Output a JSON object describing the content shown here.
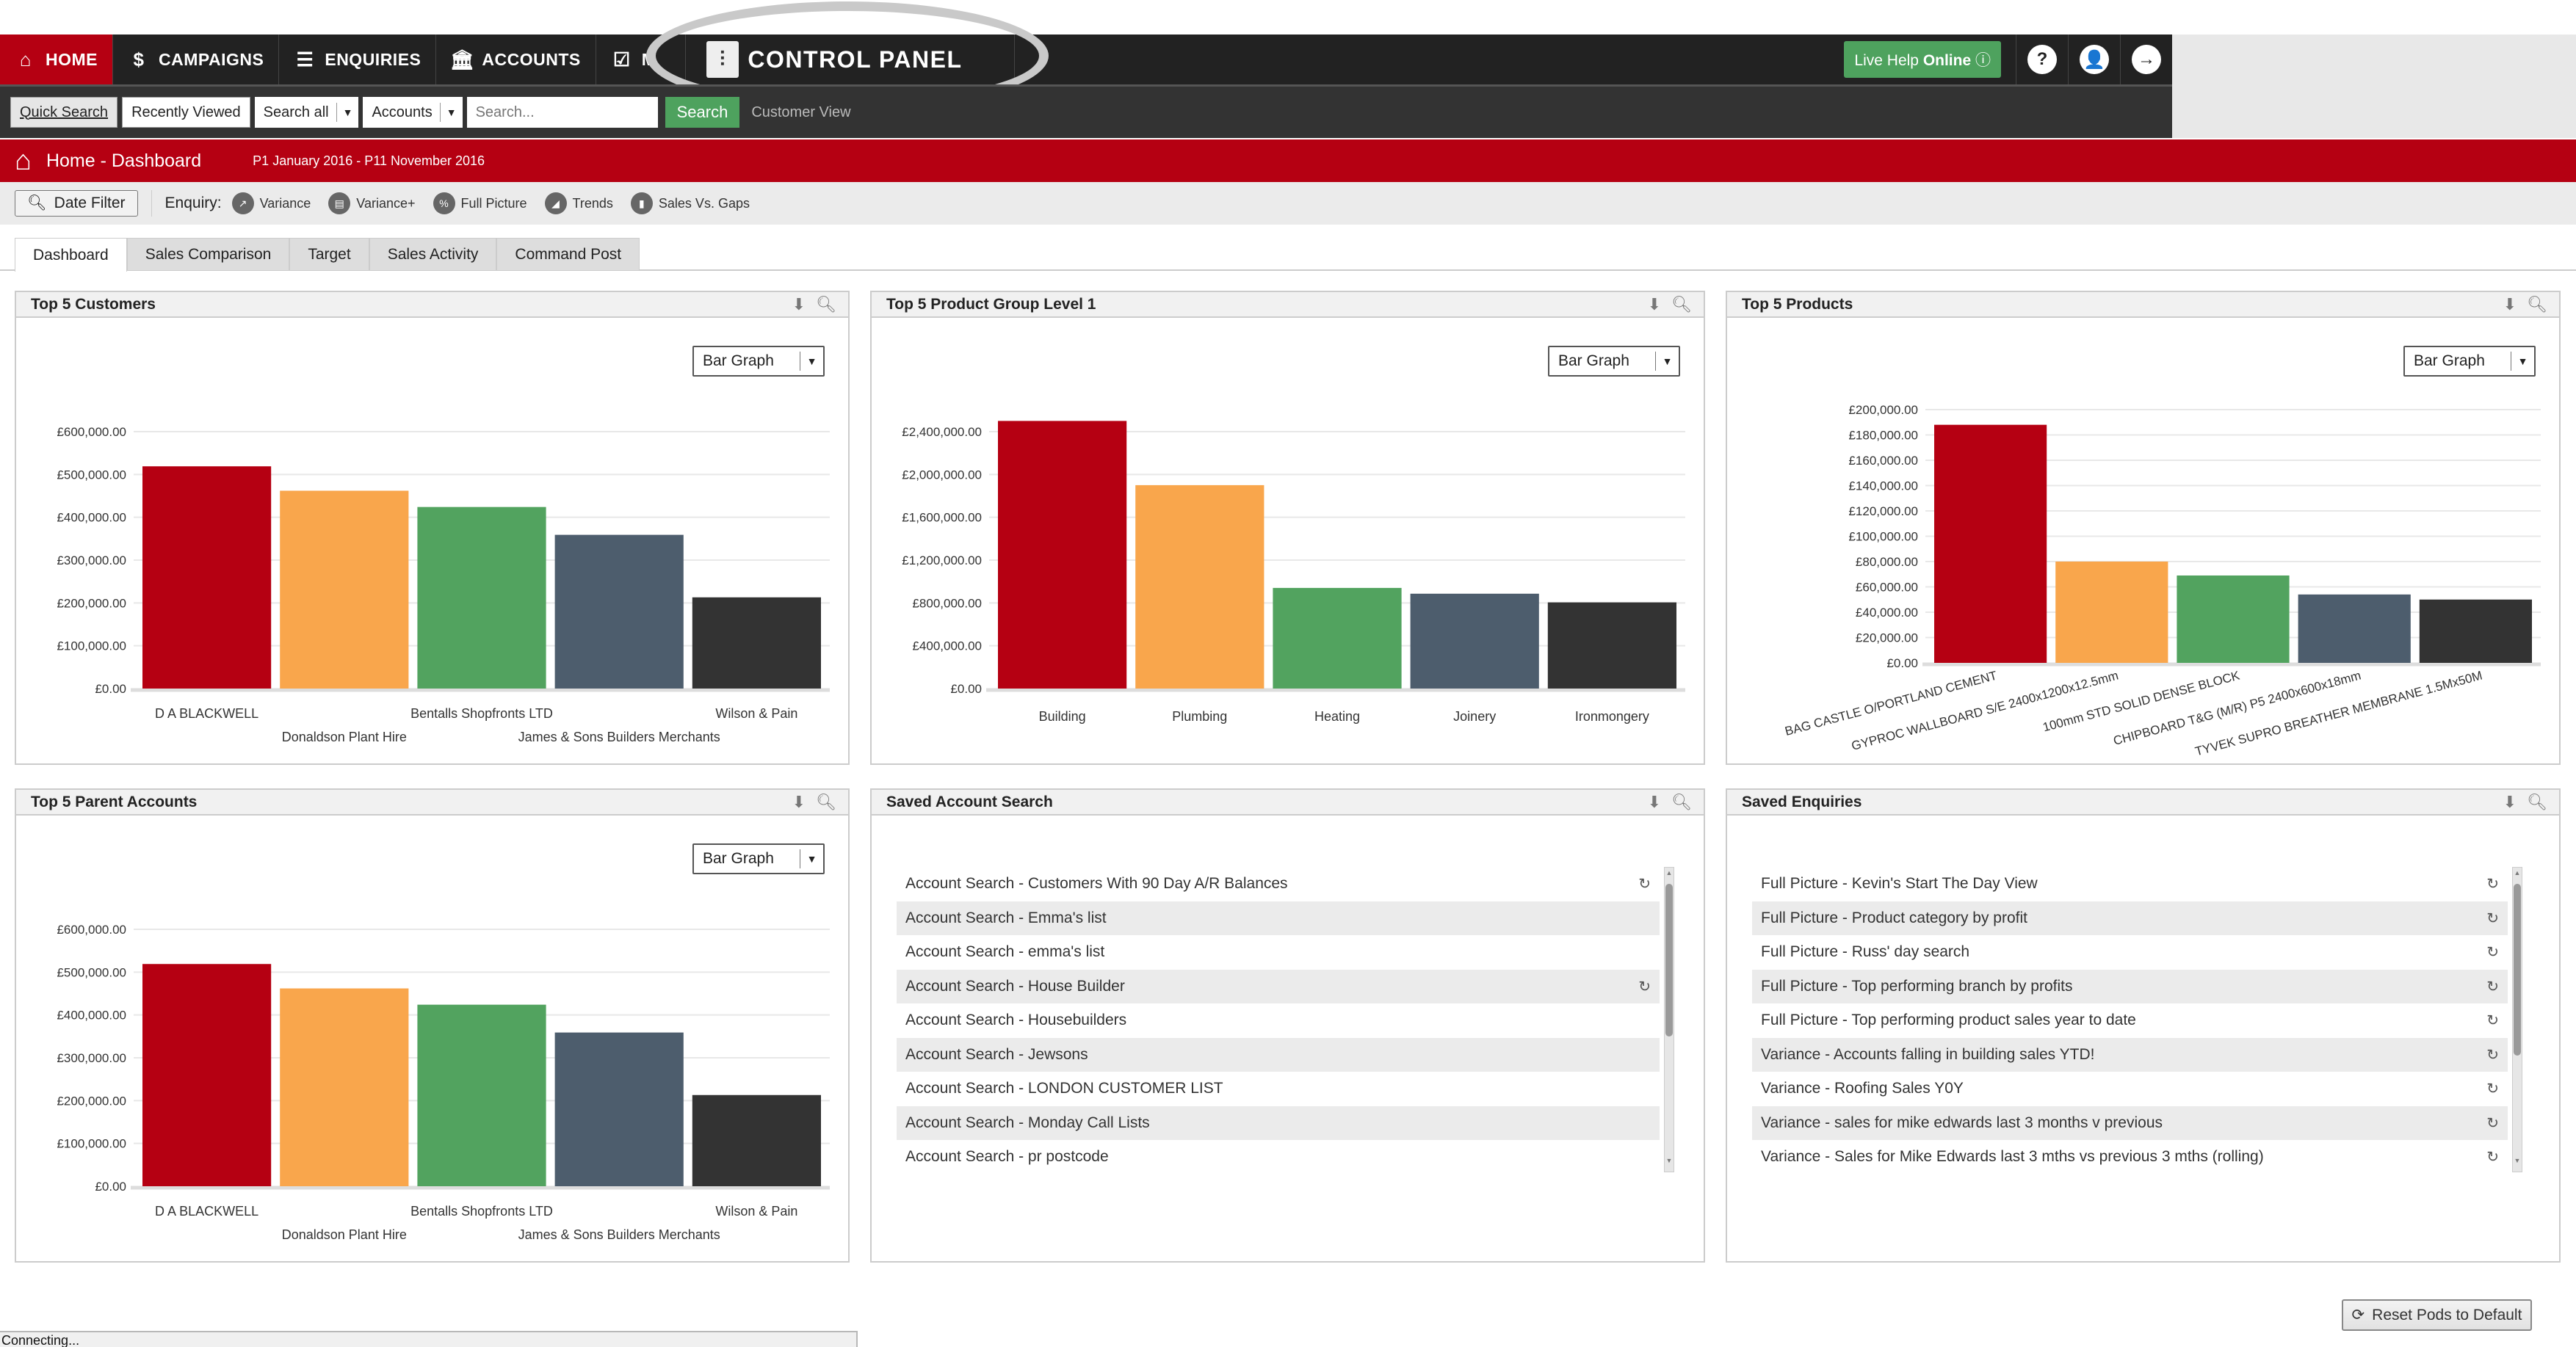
{
  "nav": {
    "items": [
      {
        "label": "HOME",
        "icon": "home-icon",
        "active": true
      },
      {
        "label": "CAMPAIGNS",
        "icon": "campaigns-icon",
        "active": false
      },
      {
        "label": "ENQUIRIES",
        "icon": "enquiries-icon",
        "active": false
      },
      {
        "label": "ACCOUNTS",
        "icon": "accounts-icon",
        "active": false
      },
      {
        "label": "M",
        "icon": "checklist-icon",
        "active": false
      }
    ],
    "control_panel": "CONTROL PANEL",
    "live_help_prefix": "Live Help ",
    "live_help_status": "Online",
    "help_icon": "?",
    "user_icon": "user-icon",
    "logout_icon": "logout-icon"
  },
  "searchbar": {
    "quick_search": "Quick Search",
    "recently_viewed": "Recently Viewed",
    "scope_select": "Search all",
    "type_select": "Accounts",
    "search_placeholder": "Search...",
    "search_button": "Search",
    "customer_view": "Customer View"
  },
  "breadcrumb": {
    "title": "Home - Dashboard",
    "date_range": "P1 January 2016 - P11 November 2016"
  },
  "toolbar": {
    "date_filter": "Date Filter",
    "enquiry_label": "Enquiry:",
    "enquiries": [
      {
        "label": "Variance",
        "icon": "variance-icon"
      },
      {
        "label": "Variance+",
        "icon": "variance-plus-icon"
      },
      {
        "label": "Full Picture",
        "icon": "full-picture-icon"
      },
      {
        "label": "Trends",
        "icon": "trends-icon"
      },
      {
        "label": "Sales Vs. Gaps",
        "icon": "sales-gaps-icon"
      }
    ]
  },
  "tabs": [
    {
      "label": "Dashboard",
      "active": true
    },
    {
      "label": "Sales Comparison",
      "active": false
    },
    {
      "label": "Target",
      "active": false
    },
    {
      "label": "Sales Activity",
      "active": false
    },
    {
      "label": "Command Post",
      "active": false
    }
  ],
  "graph_select_label": "Bar Graph",
  "bar_colors": [
    "#b50012",
    "#f9a64c",
    "#52a35f",
    "#4d5d6d",
    "#333333"
  ],
  "chart_data": [
    {
      "type": "bar",
      "title": "Top 5 Customers",
      "categories": [
        "D A BLACKWELL",
        "Donaldson Plant Hire",
        "Bentalls Shopfronts LTD",
        "James & Sons Builders Merchants",
        "Wilson & Pain"
      ],
      "values": [
        519000,
        462000,
        424000,
        359000,
        213000
      ],
      "ylim": [
        0,
        600000
      ],
      "yticks": [
        0,
        100000,
        200000,
        300000,
        400000,
        500000,
        600000
      ],
      "ytick_labels": [
        "£0.00",
        "£100,000.00",
        "£200,000.00",
        "£300,000.00",
        "£400,000.00",
        "£500,000.00",
        "£600,000.00"
      ],
      "xlabel": "",
      "ylabel": "",
      "label_style": "staggered",
      "grid": true
    },
    {
      "type": "bar",
      "title": "Top 5 Product Group Level 1",
      "categories": [
        "Building",
        "Plumbing",
        "Heating",
        "Joinery",
        "Ironmongery"
      ],
      "values": [
        2500000,
        1900000,
        940000,
        886000,
        805000
      ],
      "ylim": [
        0,
        2400000
      ],
      "yticks": [
        0,
        400000,
        800000,
        1200000,
        1600000,
        2000000,
        2400000
      ],
      "ytick_labels": [
        "£0.00",
        "£400,000.00",
        "£800,000.00",
        "£1,200,000.00",
        "£1,600,000.00",
        "£2,000,000.00",
        "£2,400,000.00"
      ],
      "xlabel": "",
      "ylabel": "",
      "label_style": "straight",
      "grid": true
    },
    {
      "type": "bar",
      "title": "Top 5 Products",
      "categories": [
        "BAG CASTLE O/PORTLAND CEMENT",
        "GYPROC WALLBOARD S/E 2400x1200x12.5mm",
        "100mm STD SOLID DENSE BLOCK",
        "CHIPBOARD T&G (M/R) P5 2400x600x18mm",
        "TYVEK SUPRO BREATHER MEMBRANE 1.5Mx50M"
      ],
      "values": [
        188000,
        80000,
        69000,
        54000,
        50000
      ],
      "ylim": [
        0,
        200000
      ],
      "yticks": [
        0,
        20000,
        40000,
        60000,
        80000,
        100000,
        120000,
        140000,
        160000,
        180000,
        200000
      ],
      "ytick_labels": [
        "£0.00",
        "£20,000.00",
        "£40,000.00",
        "£60,000.00",
        "£80,000.00",
        "£100,000.00",
        "£120,000.00",
        "£140,000.00",
        "£160,000.00",
        "£180,000.00",
        "£200,000.00"
      ],
      "xlabel": "",
      "ylabel": "",
      "label_style": "rotated",
      "grid": true
    },
    {
      "type": "bar",
      "title": "Top 5 Parent Accounts",
      "categories": [
        "D A BLACKWELL",
        "Donaldson Plant Hire",
        "Bentalls Shopfronts LTD",
        "James & Sons Builders Merchants",
        "Wilson & Pain"
      ],
      "values": [
        519000,
        462000,
        424000,
        359000,
        213000
      ],
      "ylim": [
        0,
        600000
      ],
      "yticks": [
        0,
        100000,
        200000,
        300000,
        400000,
        500000,
        600000
      ],
      "ytick_labels": [
        "£0.00",
        "£100,000.00",
        "£200,000.00",
        "£300,000.00",
        "£400,000.00",
        "£500,000.00",
        "£600,000.00"
      ],
      "xlabel": "",
      "ylabel": "",
      "label_style": "staggered",
      "grid": true
    }
  ],
  "saved_account_search": {
    "title": "Saved Account Search",
    "items": [
      {
        "label": "Account Search - Customers With 90 Day A/R Balances",
        "refresh": true
      },
      {
        "label": "Account Search - Emma's list",
        "refresh": false
      },
      {
        "label": "Account Search - emma's list",
        "refresh": false
      },
      {
        "label": "Account Search - House Builder",
        "refresh": true
      },
      {
        "label": "Account Search - Housebuilders",
        "refresh": false
      },
      {
        "label": "Account Search - Jewsons",
        "refresh": false
      },
      {
        "label": "Account Search - LONDON CUSTOMER LIST",
        "refresh": false
      },
      {
        "label": "Account Search - Monday Call Lists",
        "refresh": false
      },
      {
        "label": "Account Search - pr postcode",
        "refresh": false
      }
    ]
  },
  "saved_enquiries": {
    "title": "Saved Enquiries",
    "items": [
      {
        "label": "Full Picture - Kevin's Start The Day View",
        "refresh": true
      },
      {
        "label": "Full Picture - Product category by profit",
        "refresh": true
      },
      {
        "label": "Full Picture - Russ' day search",
        "refresh": true
      },
      {
        "label": "Full Picture - Top performing branch by profits",
        "refresh": true
      },
      {
        "label": "Full Picture - Top performing product sales year to date",
        "refresh": true
      },
      {
        "label": "Variance - Accounts falling in building sales YTD!",
        "refresh": true
      },
      {
        "label": "Variance - Roofing Sales Y0Y",
        "refresh": true
      },
      {
        "label": "Variance - sales for mike edwards last 3 months v previous",
        "refresh": true
      },
      {
        "label": "Variance - Sales for Mike Edwards last 3 mths vs previous 3 mths (rolling)",
        "refresh": true
      }
    ]
  },
  "footer": {
    "status": "Connecting...",
    "reset_button": "Reset Pods to Default"
  }
}
